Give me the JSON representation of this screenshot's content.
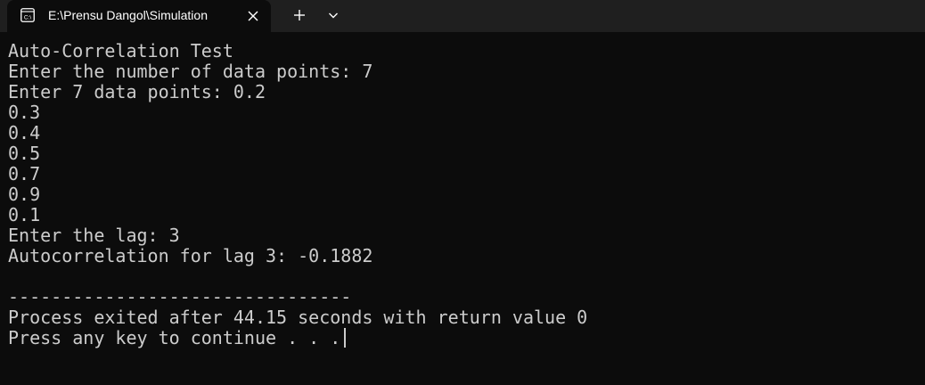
{
  "window": {
    "tab_title": "E:\\Prensu Dangol\\Simulation",
    "tab_icon": "console-icon",
    "icons": {
      "close": "close-icon",
      "new_tab": "plus-icon",
      "dropdown": "chevron-down-icon"
    },
    "colors": {
      "background": "#0c0c0c",
      "tab_bar": "#1f1f1f",
      "text": "#cccccc",
      "tab_text": "#ffffff"
    }
  },
  "console": {
    "lines": [
      "Auto-Correlation Test",
      "Enter the number of data points: 7",
      "Enter 7 data points: 0.2",
      "0.3",
      "0.4",
      "0.5",
      "0.7",
      "0.9",
      "0.1",
      "Enter the lag: 3",
      "Autocorrelation for lag 3: -0.1882",
      "",
      "--------------------------------",
      "Process exited after 44.15 seconds with return value 0",
      "Press any key to continue . . ."
    ]
  }
}
